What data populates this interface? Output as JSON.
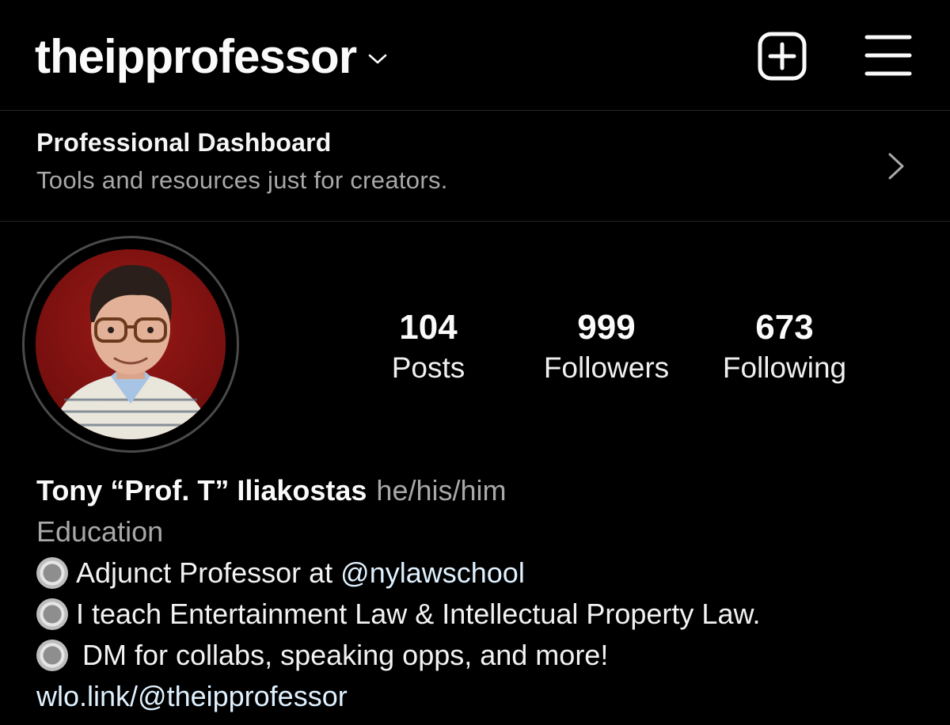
{
  "header": {
    "username": "theipprofessor",
    "switch_account_icon": "chevron-down-icon",
    "new_post_icon": "plus-square-icon",
    "menu_icon": "hamburger-menu-icon"
  },
  "dashboard": {
    "title": "Professional Dashboard",
    "subtitle": "Tools and resources just for creators.",
    "arrow_icon": "chevron-right-icon"
  },
  "profile": {
    "avatar": "profile-photo",
    "stats": {
      "posts": {
        "value": "104",
        "label": "Posts"
      },
      "followers": {
        "value": "999",
        "label": "Followers"
      },
      "following": {
        "value": "673",
        "label": "Following"
      }
    }
  },
  "bio": {
    "name": "Tony “Prof. T” Iliakostas",
    "pronouns": "he/his/him",
    "category": "Education",
    "lines": [
      {
        "text": "Adjunct Professor at",
        "mention": "@nylawschool"
      },
      {
        "text": "I teach Entertainment Law & Intellectual Property Law."
      },
      {
        "text": "DM for collabs, speaking opps, and more!"
      }
    ],
    "link": "wlo.link/@theipprofessor"
  },
  "colors": {
    "background": "#000000",
    "text_primary": "#f5f5f5",
    "text_secondary": "#a8a8a8",
    "link": "#e0f1ff",
    "divider": "#262626"
  }
}
